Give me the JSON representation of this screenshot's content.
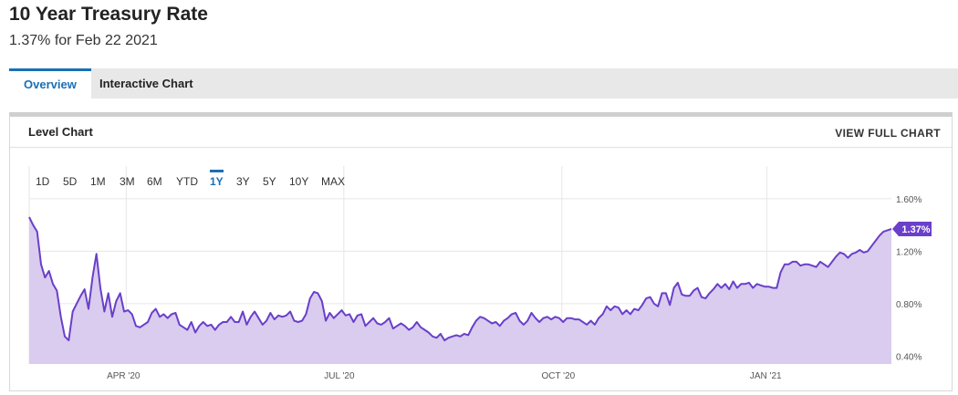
{
  "header": {
    "title": "10 Year Treasury Rate",
    "subtitle": "1.37% for Feb 22 2021"
  },
  "tabs": [
    {
      "label": "Overview",
      "active": true
    },
    {
      "label": "Interactive Chart",
      "active": false
    }
  ],
  "panel": {
    "title": "Level Chart",
    "view_full": "VIEW FULL CHART"
  },
  "range_buttons": [
    "1D",
    "5D",
    "1M",
    "3M",
    "6M",
    "YTD",
    "1Y",
    "3Y",
    "5Y",
    "10Y",
    "MAX"
  ],
  "active_range": "1Y",
  "colors": {
    "line": "#6a3fc9",
    "fill": "#d9ccef",
    "tab_accent": "#1a6fb5",
    "grid": "#e6e6e6"
  },
  "chart_data": {
    "type": "area",
    "title": "",
    "xlabel": "",
    "ylabel": "",
    "ylim": [
      0.34,
      1.85
    ],
    "x_ticks": [
      "APR '20",
      "JUL '20",
      "OCT '20",
      "JAN '21"
    ],
    "y_ticks": [
      "0.40%",
      "0.80%",
      "1.20%",
      "1.60%"
    ],
    "last_value_label": "1.37%",
    "grid": true,
    "series": [
      {
        "values": [
          1.46,
          1.4,
          1.35,
          1.1,
          1.0,
          1.05,
          0.95,
          0.9,
          0.7,
          0.55,
          0.52,
          0.74,
          0.8,
          0.86,
          0.91,
          0.76,
          1.0,
          1.18,
          0.92,
          0.74,
          0.88,
          0.7,
          0.82,
          0.88,
          0.74,
          0.75,
          0.72,
          0.63,
          0.62,
          0.64,
          0.66,
          0.73,
          0.76,
          0.7,
          0.72,
          0.69,
          0.72,
          0.73,
          0.64,
          0.62,
          0.6,
          0.66,
          0.58,
          0.63,
          0.66,
          0.63,
          0.64,
          0.6,
          0.64,
          0.66,
          0.66,
          0.7,
          0.66,
          0.66,
          0.74,
          0.64,
          0.7,
          0.74,
          0.69,
          0.64,
          0.67,
          0.73,
          0.68,
          0.71,
          0.7,
          0.71,
          0.74,
          0.67,
          0.66,
          0.67,
          0.72,
          0.84,
          0.89,
          0.88,
          0.82,
          0.67,
          0.73,
          0.69,
          0.72,
          0.75,
          0.71,
          0.72,
          0.66,
          0.71,
          0.72,
          0.63,
          0.66,
          0.69,
          0.65,
          0.64,
          0.66,
          0.69,
          0.61,
          0.63,
          0.65,
          0.63,
          0.6,
          0.62,
          0.66,
          0.62,
          0.6,
          0.58,
          0.55,
          0.54,
          0.57,
          0.52,
          0.54,
          0.55,
          0.56,
          0.55,
          0.57,
          0.56,
          0.62,
          0.67,
          0.7,
          0.69,
          0.67,
          0.65,
          0.66,
          0.63,
          0.67,
          0.69,
          0.72,
          0.73,
          0.67,
          0.64,
          0.67,
          0.73,
          0.69,
          0.66,
          0.69,
          0.7,
          0.68,
          0.7,
          0.69,
          0.66,
          0.69,
          0.69,
          0.68,
          0.68,
          0.66,
          0.64,
          0.67,
          0.64,
          0.69,
          0.72,
          0.78,
          0.75,
          0.78,
          0.77,
          0.72,
          0.75,
          0.72,
          0.76,
          0.75,
          0.79,
          0.84,
          0.85,
          0.8,
          0.78,
          0.88,
          0.88,
          0.79,
          0.92,
          0.96,
          0.87,
          0.86,
          0.86,
          0.9,
          0.92,
          0.85,
          0.84,
          0.88,
          0.91,
          0.95,
          0.92,
          0.95,
          0.91,
          0.97,
          0.92,
          0.95,
          0.95,
          0.96,
          0.92,
          0.95,
          0.94,
          0.93,
          0.93,
          0.92,
          0.92,
          1.04,
          1.1,
          1.1,
          1.12,
          1.12,
          1.09,
          1.1,
          1.1,
          1.09,
          1.08,
          1.12,
          1.1,
          1.08,
          1.12,
          1.16,
          1.19,
          1.18,
          1.15,
          1.18,
          1.19,
          1.21,
          1.19,
          1.2,
          1.24,
          1.28,
          1.32,
          1.35,
          1.36,
          1.37
        ]
      }
    ]
  }
}
